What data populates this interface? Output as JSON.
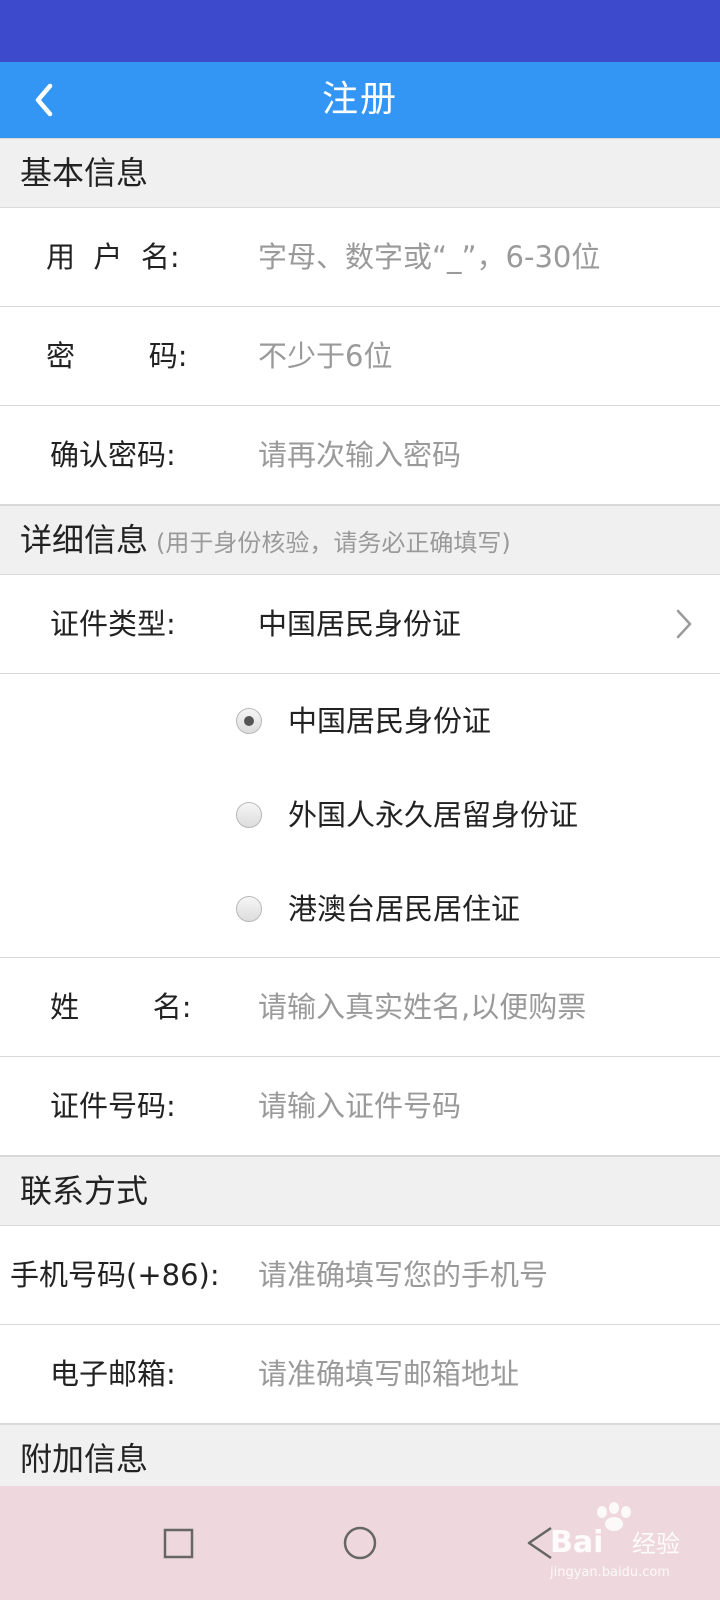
{
  "app_bar": {
    "title": "注册",
    "accent": "#3396f4",
    "status_color": "#3e4acc"
  },
  "sections": {
    "basic": {
      "title": "基本信息"
    },
    "detail": {
      "title": "详细信息",
      "note": "(用于身份核验，请务必正确填写)"
    },
    "contact": {
      "title": "联系方式"
    },
    "extra": {
      "title": "附加信息"
    }
  },
  "fields": {
    "username": {
      "label": "用  户  名:",
      "placeholder": "字母、数字或“_”，6-30位"
    },
    "password": {
      "label": "密        码:",
      "placeholder": "不少于6位"
    },
    "confirm_password": {
      "label": "确认密码:",
      "placeholder": "请再次输入密码"
    },
    "id_type": {
      "label": "证件类型:",
      "value": "中国居民身份证"
    },
    "name": {
      "label": "姓        名:",
      "placeholder": "请输入真实姓名,以便购票"
    },
    "id_number": {
      "label": "证件号码:",
      "placeholder": "请输入证件号码"
    },
    "phone": {
      "label": "手机号码(+86):",
      "placeholder": "请准确填写您的手机号"
    },
    "email": {
      "label": "电子邮箱:",
      "placeholder": "请准确填写邮箱地址"
    }
  },
  "id_options": [
    {
      "label": "中国居民身份证",
      "selected": true
    },
    {
      "label": "外国人永久居留身份证",
      "selected": false
    },
    {
      "label": "港澳台居民居住证",
      "selected": false
    }
  ],
  "nav_bar": {
    "icons": [
      "recent-apps-icon",
      "home-icon",
      "back-icon"
    ]
  },
  "watermark": {
    "text": "Baidu经验",
    "sub": "jingyan.baidu.com"
  }
}
